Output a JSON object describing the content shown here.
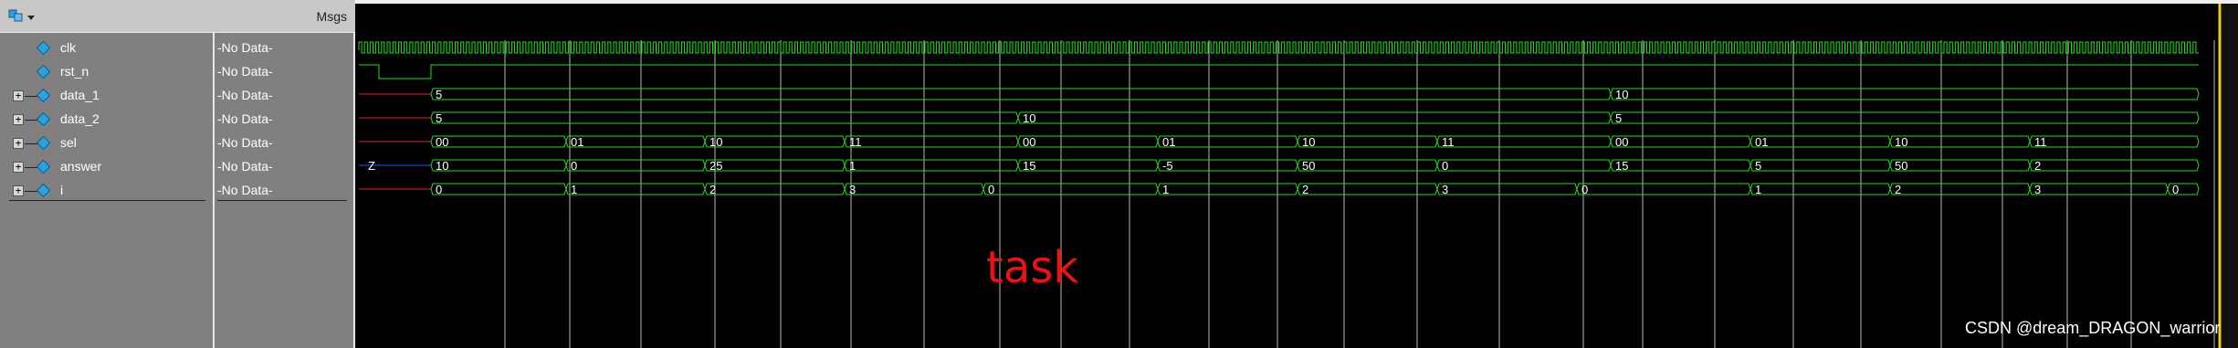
{
  "toolbar": {
    "msgs_label": "Msgs"
  },
  "signals": [
    {
      "name": "clk",
      "value": "-No Data-",
      "expandable": false
    },
    {
      "name": "rst_n",
      "value": "-No Data-",
      "expandable": false
    },
    {
      "name": "data_1",
      "value": "-No Data-",
      "expandable": true
    },
    {
      "name": "data_2",
      "value": "-No Data-",
      "expandable": true
    },
    {
      "name": "sel",
      "value": "-No Data-",
      "expandable": true
    },
    {
      "name": "answer",
      "value": "-No Data-",
      "expandable": true
    },
    {
      "name": "i",
      "value": "-No Data-",
      "expandable": true
    }
  ],
  "buses": {
    "data_1": [
      "5",
      "10"
    ],
    "data_2": [
      "5",
      "10",
      "5"
    ],
    "sel": [
      "00",
      "01",
      "10",
      "11",
      "00",
      "01",
      "10",
      "11",
      "00",
      "01",
      "10",
      "11"
    ],
    "answer": [
      "Z",
      "10",
      "0",
      "25",
      "1",
      "15",
      "-5",
      "50",
      "0",
      "15",
      "5",
      "50",
      "2"
    ],
    "i": [
      "0",
      "1",
      "2",
      "3",
      "0",
      "1",
      "2",
      "3",
      "0",
      "1",
      "2",
      "3",
      "0"
    ]
  },
  "watermark": "task",
  "credit": "CSDN @dream_DRAGON_warrior",
  "colors": {
    "wave": "#20e020",
    "undefined": "#e02020",
    "highZ": "#2050ff",
    "grid": "#b8b8b8",
    "cursor": "#f0d000",
    "watermark": "#ee1111"
  }
}
